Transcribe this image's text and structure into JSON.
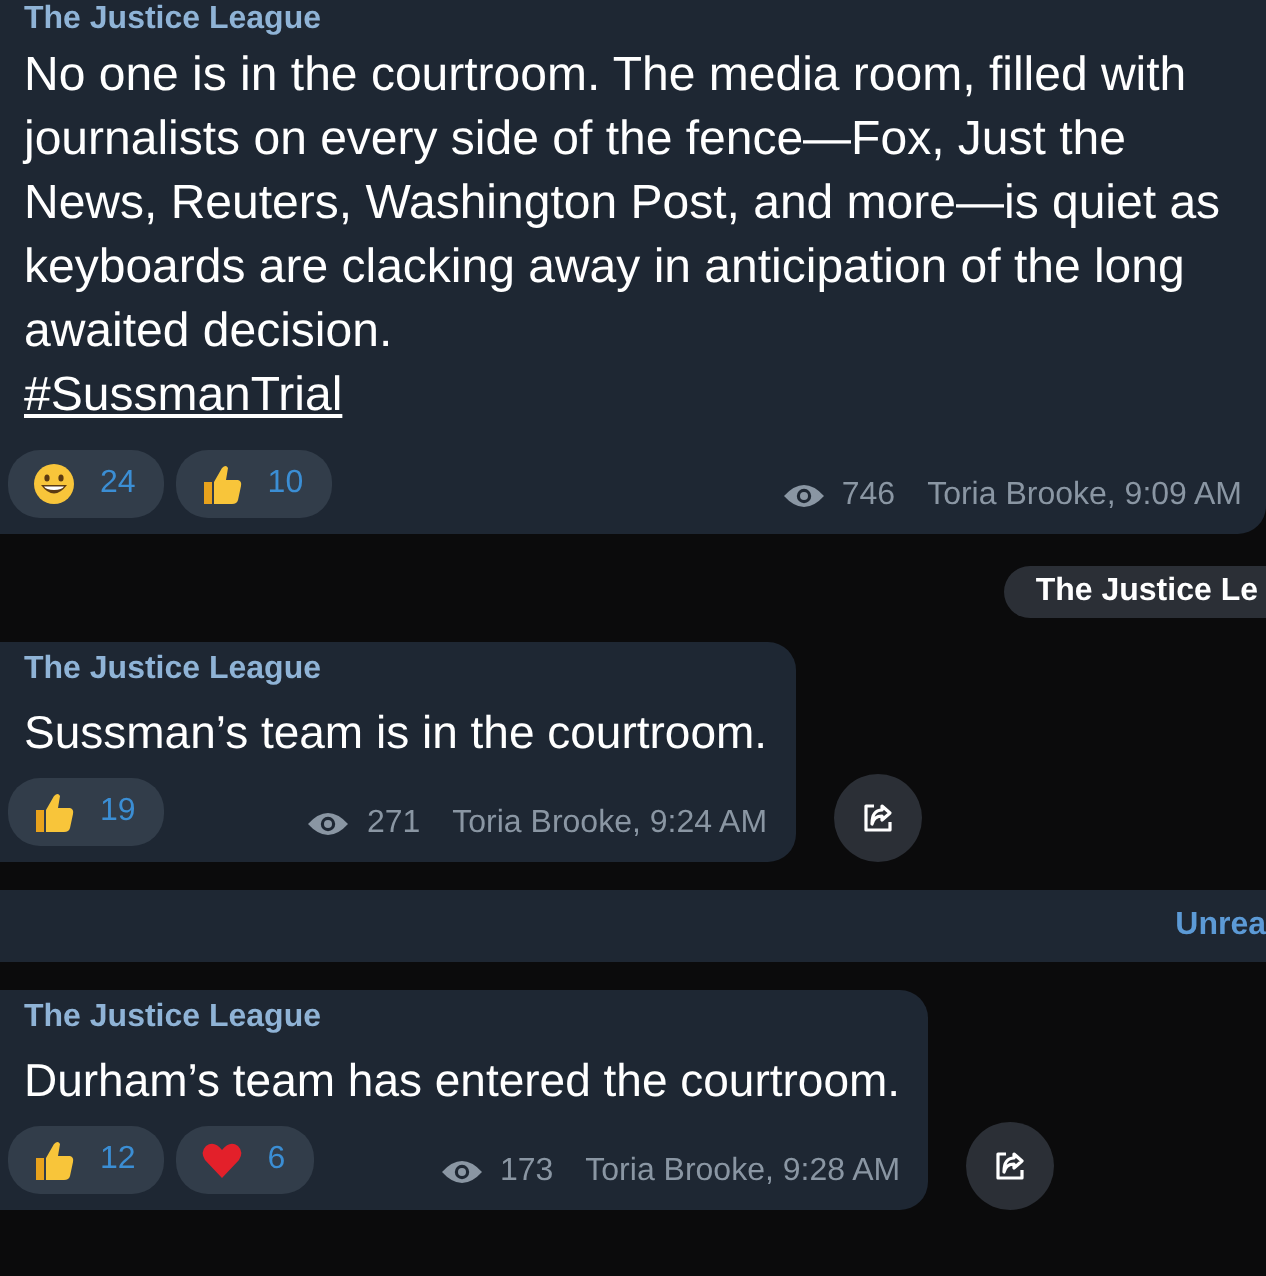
{
  "messages": [
    {
      "kind": "message",
      "sender": "The Justice League",
      "text": "No one is in the courtroom. The media room, filled with journalists on every side of the fence—Fox, Just the News, Reuters, Washington Post, and more—is quiet as keyboards are clacking away in anticipation of the long awaited decision.",
      "hashtag": "#SussmanTrial",
      "reactions": [
        {
          "kind": "grin",
          "count": "24"
        },
        {
          "kind": "thumbs_up",
          "count": "10"
        }
      ],
      "views": "746",
      "signature": "Toria Brooke, 9:09 AM",
      "share": false
    },
    {
      "kind": "chip",
      "text": "The Justice Le"
    },
    {
      "kind": "message",
      "sender": "The Justice League",
      "text": "Sussman’s team is in the courtroom.",
      "reactions": [
        {
          "kind": "thumbs_up",
          "count": "19"
        }
      ],
      "views": "271",
      "signature": "Toria Brooke, 9:24 AM",
      "share": true
    },
    {
      "kind": "unread",
      "text": "Unrea"
    },
    {
      "kind": "message",
      "sender": "The Justice League",
      "text": "Durham’s team has entered the courtroom.",
      "reactions": [
        {
          "kind": "thumbs_up",
          "count": "12"
        },
        {
          "kind": "heart",
          "count": "6"
        }
      ],
      "views": "173",
      "signature": "Toria Brooke, 9:28 AM",
      "share": true
    }
  ]
}
